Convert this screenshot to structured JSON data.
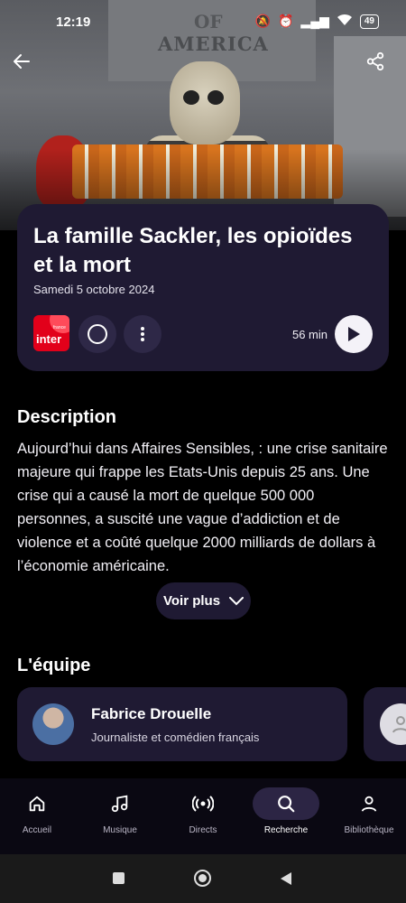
{
  "status_bar": {
    "time": "12:19",
    "battery": "49"
  },
  "hero": {
    "engraving_top": "OF",
    "engraving": "AMERICA"
  },
  "episode": {
    "title": "La famille Sackler, les opioïdes et la mort",
    "date": "Samedi 5 octobre 2024",
    "duration": "56 min",
    "station_logo": {
      "brand": "france",
      "word": "inter",
      "color": "#e2001a"
    }
  },
  "description": {
    "heading": "Description",
    "text": "Aujourd’hui dans Affaires Sensibles, : une crise sanitaire majeure qui frappe les Etats-Unis depuis 25 ans. Une crise qui a causé la mort de quelque 500 000 personnes, a suscité une vague d’addiction et de violence et a coûté quelque 2000 milliards de dollars à l’économie américaine.",
    "more_label": "Voir plus"
  },
  "team": {
    "heading": "L'équipe",
    "members": [
      {
        "name": "Fabrice Drouelle",
        "role": "Journaliste et comédien français"
      }
    ]
  },
  "nav": {
    "items": [
      {
        "label": "Accueil",
        "icon": "home-icon"
      },
      {
        "label": "Musique",
        "icon": "music-icon"
      },
      {
        "label": "Directs",
        "icon": "live-icon"
      },
      {
        "label": "Recherche",
        "icon": "search-icon",
        "active": true
      },
      {
        "label": "Bibliothèque",
        "icon": "user-icon"
      }
    ]
  },
  "colors": {
    "card": "#1f1a33",
    "background": "#000000",
    "accent": "#e2001a"
  }
}
